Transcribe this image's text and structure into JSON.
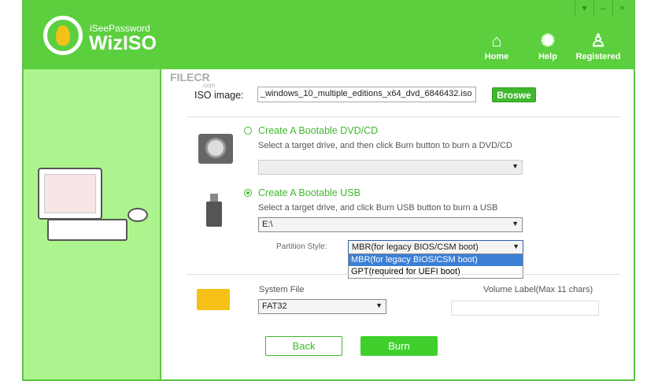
{
  "app": {
    "brand_small": "iSeePassword",
    "brand": "WizISO"
  },
  "nav": [
    {
      "label": "Home",
      "icon": "home-icon"
    },
    {
      "label": "Help",
      "icon": "lightbulb-icon"
    },
    {
      "label": "Registered",
      "icon": "user-icon"
    }
  ],
  "window_controls": {
    "menu": "▾",
    "minimize": "–",
    "close": "×"
  },
  "watermark": {
    "text": "FILECR",
    "sub": ".com"
  },
  "iso": {
    "label": "ISO image:",
    "value": "_windows_10_multiple_editions_x64_dvd_6846432.iso",
    "browse": "Broswe"
  },
  "dvd": {
    "title": "Create A Bootable DVD/CD",
    "desc": "Select a target drive, and then click Burn button to burn a DVD/CD",
    "selected": false,
    "drive": ""
  },
  "usb": {
    "title": "Create A Bootable USB",
    "desc": "Select a target drive, and click Burn USB button to burn a USB",
    "selected": true,
    "drive": "E:\\"
  },
  "partition": {
    "label": "Partition Style:",
    "value": "MBR(for legacy BIOS/CSM boot)",
    "options": [
      "MBR(for legacy BIOS/CSM boot)",
      "GPT(required for UEFI boot)"
    ]
  },
  "system_file": {
    "label": "System File",
    "value": "FAT32"
  },
  "volume": {
    "label": "Volume Label(Max 11 chars)",
    "value": ""
  },
  "buttons": {
    "back": "Back",
    "burn": "Burn"
  }
}
